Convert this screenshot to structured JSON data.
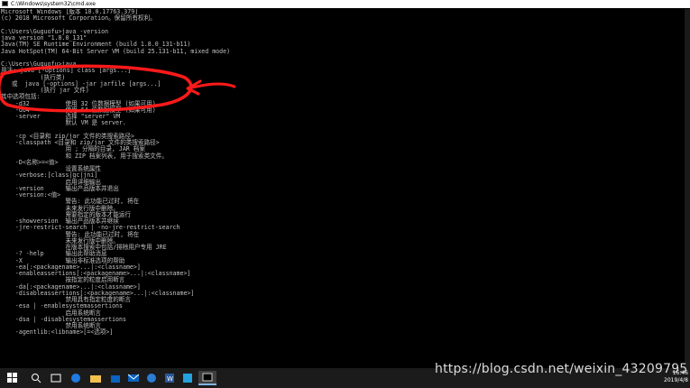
{
  "window": {
    "title": "C:\\Windows\\system32\\cmd.exe"
  },
  "console_lines": [
    "Microsoft Windows [版本 10.0.17763.379]",
    "(c) 2018 Microsoft Corporation。保留所有权利。",
    "",
    "C:\\Users\\Guguofu>java -version",
    "java version \"1.8.0_131\"",
    "Java(TM) SE Runtime Environment (build 1.8.0_131-b11)",
    "Java HotSpot(TM) 64-Bit Server VM (build 25.131-b11, mixed mode)",
    "",
    "C:\\Users\\Guguofu>java",
    "用法: java [-options] class [args...]",
    "           (执行类)",
    "   或  java [-options] -jar jarfile [args...]",
    "           (执行 jar 文件)",
    "其中选项包括:",
    "    -d32          使用 32 位数据模型 (如果可用)",
    "    -d64          使用 64 位数据模型 (如果可用)",
    "    -server       选择 \"server\" VM",
    "                  默认 VM 是 server.",
    "",
    "    -cp <目录和 zip/jar 文件的类搜索路径>",
    "    -classpath <目录和 zip/jar 文件的类搜索路径>",
    "                  用 ; 分隔的目录, JAR 档案",
    "                  和 ZIP 档案列表, 用于搜索类文件。",
    "    -D<名称>=<值>",
    "                  设置系统属性",
    "    -verbose:[class|gc|jni]",
    "                  启用详细输出",
    "    -version      输出产品版本并退出",
    "    -version:<值>",
    "                  警告: 此功能已过时, 将在",
    "                  未来发行版中删除。",
    "                  需要指定的版本才能运行",
    "    -showversion  输出产品版本并继续",
    "    -jre-restrict-search | -no-jre-restrict-search",
    "                  警告: 此功能已过时, 将在",
    "                  未来发行版中删除。",
    "                  在版本搜索中包括/排除用户专用 JRE",
    "    -? -help      输出此帮助消息",
    "    -X            输出非标准选项的帮助",
    "    -ea[:<packagename>...|:<classname>]",
    "    -enableassertions[:<packagename>...|:<classname>]",
    "                  按指定的粒度启用断言",
    "    -da[:<packagename>...|:<classname>]",
    "    -disableassertions[:<packagename>...|:<classname>]",
    "                  禁用具有指定粒度的断言",
    "    -esa | -enablesystemassertions",
    "                  启用系统断言",
    "    -dsa | -disablesystemassertions",
    "                  禁用系统断言",
    "    -agentlib:<libname>[=<选项>]"
  ],
  "watermark": "https://blog.csdn.net/weixin_43209795",
  "taskbar": {
    "items": [
      {
        "name": "start-icon"
      },
      {
        "name": "search-icon"
      },
      {
        "name": "task-view-icon"
      },
      {
        "name": "browser-icon"
      },
      {
        "name": "file-explorer-icon"
      },
      {
        "name": "store-icon"
      },
      {
        "name": "mail-icon"
      },
      {
        "name": "edge-icon"
      },
      {
        "name": "word-icon"
      },
      {
        "name": "vscode-icon"
      },
      {
        "name": "cmd-icon",
        "active": true
      }
    ],
    "clock_time": "16:46",
    "clock_date": "2019/4/8"
  },
  "annotation": {
    "color": "#ff1a1a"
  }
}
